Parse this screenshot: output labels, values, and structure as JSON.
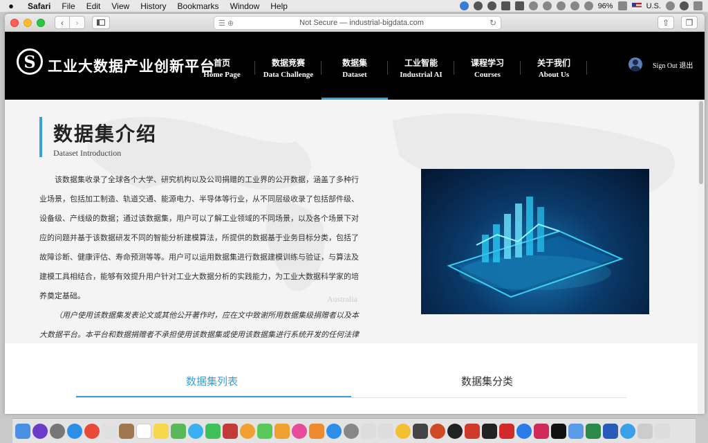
{
  "menubar": {
    "app_name": "Safari",
    "items": [
      "File",
      "Edit",
      "View",
      "History",
      "Bookmarks",
      "Window",
      "Help"
    ],
    "battery": "96%",
    "input_source": "U.S."
  },
  "browser": {
    "address": "Not Secure — industrial-bigdata.com"
  },
  "site": {
    "title": "工业大数据产业创新平台",
    "logo_letter": "S",
    "nav": [
      {
        "zh": "首页",
        "en": "Home Page"
      },
      {
        "zh": "数据竞赛",
        "en": "Data Challenge"
      },
      {
        "zh": "数据集",
        "en": "Dataset"
      },
      {
        "zh": "工业智能",
        "en": "Industrial AI"
      },
      {
        "zh": "课程学习",
        "en": "Courses"
      },
      {
        "zh": "关于我们",
        "en": "About Us"
      }
    ],
    "active_nav": "数据集",
    "signout": "Sign Out 退出"
  },
  "intro": {
    "title": "数据集介绍",
    "subtitle": "Dataset Introduction",
    "body": "该数据集收录了全球各个大学、研究机构以及公司捐赠的工业界的公开数据，涵盖了多种行业场景，包括加工制造、轨道交通、能源电力、半导体等行业，从不同层级收录了包括部件级、设备级、产线级的数据；通过该数据集，用户可以了解工业领域的不同场景，以及各个场景下对应的问题并基于该数据研发不同的智能分析建模算法，所提供的数据基于业务目标分类，包括了故障诊断、健康评估、寿命预测等等。用户可以运用数据集进行数据建模训练与验证，与算法及建模工具相结合，能够有效提升用户针对工业大数据分析的实践能力，为工业大数据科学家的培养奠定基础。",
    "note": "（用户使用该数据集发表论文或其他公开著作时，应在文中致谢所用数据集级捐赠者以及本大数据平台。本平台和数据捐赠者不承担使用该数据集或使用该数据集进行系统开发的任何法律责任。）",
    "map_label": "Australia"
  },
  "tabs": {
    "list": "数据集列表",
    "category": "数据集分类"
  },
  "colors": {
    "accent": "#3aa0d8",
    "header_bg": "#000000"
  }
}
